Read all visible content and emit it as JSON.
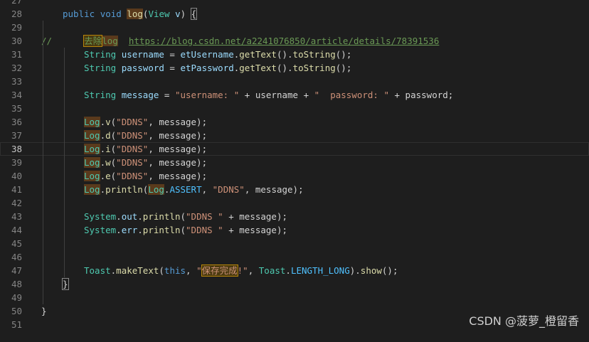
{
  "editor": {
    "lines": [
      {
        "num": "27",
        "indent": 0,
        "tokens": []
      },
      {
        "num": "28",
        "indent": 30,
        "tokens": [
          {
            "t": "public",
            "c": "kw"
          },
          {
            "t": " ",
            "c": "plain"
          },
          {
            "t": "void",
            "c": "kw"
          },
          {
            "t": " ",
            "c": "plain"
          },
          {
            "t": "log",
            "c": "fn",
            "h": "word"
          },
          {
            "t": "(",
            "c": "plain"
          },
          {
            "t": "View",
            "c": "type"
          },
          {
            "t": " ",
            "c": "plain"
          },
          {
            "t": "v",
            "c": "var"
          },
          {
            "t": ") ",
            "c": "plain"
          },
          {
            "t": "{",
            "c": "plain",
            "h": "brace"
          }
        ]
      },
      {
        "num": "29",
        "indent": 0,
        "tokens": []
      },
      {
        "num": "30",
        "indent": 0,
        "tokens": [
          {
            "t": "//      ",
            "c": "comment"
          },
          {
            "t": "去除",
            "c": "comment",
            "h": "box"
          },
          {
            "t": "log",
            "c": "comment",
            "h": "word"
          },
          {
            "t": "  ",
            "c": "comment"
          },
          {
            "t": "https://blog.csdn.net/a2241076850/article/details/78391536",
            "c": "link"
          }
        ]
      },
      {
        "num": "31",
        "indent": 60,
        "tokens": [
          {
            "t": "String",
            "c": "type"
          },
          {
            "t": " ",
            "c": "plain"
          },
          {
            "t": "username",
            "c": "var"
          },
          {
            "t": " = ",
            "c": "plain"
          },
          {
            "t": "etUsername",
            "c": "var"
          },
          {
            "t": ".",
            "c": "plain"
          },
          {
            "t": "getText",
            "c": "fn"
          },
          {
            "t": "().",
            "c": "plain"
          },
          {
            "t": "toString",
            "c": "fn"
          },
          {
            "t": "();",
            "c": "plain"
          }
        ]
      },
      {
        "num": "32",
        "indent": 60,
        "tokens": [
          {
            "t": "String",
            "c": "type"
          },
          {
            "t": " ",
            "c": "plain"
          },
          {
            "t": "password",
            "c": "var"
          },
          {
            "t": " = ",
            "c": "plain"
          },
          {
            "t": "etPassword",
            "c": "var"
          },
          {
            "t": ".",
            "c": "plain"
          },
          {
            "t": "getText",
            "c": "fn"
          },
          {
            "t": "().",
            "c": "plain"
          },
          {
            "t": "toString",
            "c": "fn"
          },
          {
            "t": "();",
            "c": "plain"
          }
        ]
      },
      {
        "num": "33",
        "indent": 0,
        "tokens": []
      },
      {
        "num": "34",
        "indent": 60,
        "tokens": [
          {
            "t": "String",
            "c": "type"
          },
          {
            "t": " ",
            "c": "plain"
          },
          {
            "t": "message",
            "c": "var"
          },
          {
            "t": " = ",
            "c": "plain"
          },
          {
            "t": "\"username: \"",
            "c": "str"
          },
          {
            "t": " + username + ",
            "c": "plain"
          },
          {
            "t": "\"  password: \"",
            "c": "str"
          },
          {
            "t": " + password;",
            "c": "plain"
          }
        ]
      },
      {
        "num": "35",
        "indent": 0,
        "tokens": []
      },
      {
        "num": "36",
        "indent": 60,
        "tokens": [
          {
            "t": "Log",
            "c": "type",
            "h": "word"
          },
          {
            "t": ".",
            "c": "plain"
          },
          {
            "t": "v",
            "c": "fn"
          },
          {
            "t": "(",
            "c": "plain"
          },
          {
            "t": "\"DDNS\"",
            "c": "str"
          },
          {
            "t": ", message);",
            "c": "plain"
          }
        ]
      },
      {
        "num": "37",
        "indent": 60,
        "tokens": [
          {
            "t": "Log",
            "c": "type",
            "h": "word"
          },
          {
            "t": ".",
            "c": "plain"
          },
          {
            "t": "d",
            "c": "fn"
          },
          {
            "t": "(",
            "c": "plain"
          },
          {
            "t": "\"DDNS\"",
            "c": "str"
          },
          {
            "t": ", message);",
            "c": "plain"
          }
        ]
      },
      {
        "num": "38",
        "indent": 60,
        "current": true,
        "tokens": [
          {
            "t": "Log",
            "c": "type",
            "h": "word"
          },
          {
            "t": ".",
            "c": "plain"
          },
          {
            "t": "i",
            "c": "fn"
          },
          {
            "t": "(",
            "c": "plain"
          },
          {
            "t": "\"DDNS\"",
            "c": "str"
          },
          {
            "t": ", message);",
            "c": "plain"
          }
        ]
      },
      {
        "num": "39",
        "indent": 60,
        "tokens": [
          {
            "t": "Log",
            "c": "type",
            "h": "word"
          },
          {
            "t": ".",
            "c": "plain"
          },
          {
            "t": "w",
            "c": "fn"
          },
          {
            "t": "(",
            "c": "plain"
          },
          {
            "t": "\"DDNS\"",
            "c": "str"
          },
          {
            "t": ", message);",
            "c": "plain"
          }
        ]
      },
      {
        "num": "40",
        "indent": 60,
        "tokens": [
          {
            "t": "Log",
            "c": "type",
            "h": "word"
          },
          {
            "t": ".",
            "c": "plain"
          },
          {
            "t": "e",
            "c": "fn"
          },
          {
            "t": "(",
            "c": "plain"
          },
          {
            "t": "\"DDNS\"",
            "c": "str"
          },
          {
            "t": ", message);",
            "c": "plain"
          }
        ]
      },
      {
        "num": "41",
        "indent": 60,
        "tokens": [
          {
            "t": "Log",
            "c": "type",
            "h": "word"
          },
          {
            "t": ".",
            "c": "plain"
          },
          {
            "t": "println",
            "c": "fn"
          },
          {
            "t": "(",
            "c": "plain"
          },
          {
            "t": "Log",
            "c": "type",
            "h": "word"
          },
          {
            "t": ".",
            "c": "plain"
          },
          {
            "t": "ASSERT",
            "c": "const"
          },
          {
            "t": ", ",
            "c": "plain"
          },
          {
            "t": "\"DDNS\"",
            "c": "str"
          },
          {
            "t": ", message);",
            "c": "plain"
          }
        ]
      },
      {
        "num": "42",
        "indent": 0,
        "tokens": []
      },
      {
        "num": "43",
        "indent": 60,
        "tokens": [
          {
            "t": "System",
            "c": "type"
          },
          {
            "t": ".",
            "c": "plain"
          },
          {
            "t": "out",
            "c": "var"
          },
          {
            "t": ".",
            "c": "plain"
          },
          {
            "t": "println",
            "c": "fn"
          },
          {
            "t": "(",
            "c": "plain"
          },
          {
            "t": "\"DDNS \"",
            "c": "str"
          },
          {
            "t": " + message);",
            "c": "plain"
          }
        ]
      },
      {
        "num": "44",
        "indent": 60,
        "tokens": [
          {
            "t": "System",
            "c": "type"
          },
          {
            "t": ".",
            "c": "plain"
          },
          {
            "t": "err",
            "c": "var"
          },
          {
            "t": ".",
            "c": "plain"
          },
          {
            "t": "println",
            "c": "fn"
          },
          {
            "t": "(",
            "c": "plain"
          },
          {
            "t": "\"DDNS \"",
            "c": "str"
          },
          {
            "t": " + message);",
            "c": "plain"
          }
        ]
      },
      {
        "num": "45",
        "indent": 0,
        "tokens": []
      },
      {
        "num": "46",
        "indent": 0,
        "tokens": []
      },
      {
        "num": "47",
        "indent": 60,
        "tokens": [
          {
            "t": "Toast",
            "c": "type"
          },
          {
            "t": ".",
            "c": "plain"
          },
          {
            "t": "makeText",
            "c": "fn"
          },
          {
            "t": "(",
            "c": "plain"
          },
          {
            "t": "this",
            "c": "kw"
          },
          {
            "t": ", ",
            "c": "plain"
          },
          {
            "t": "\"",
            "c": "str"
          },
          {
            "t": "保存完成",
            "c": "str",
            "h": "box"
          },
          {
            "t": "!\"",
            "c": "str"
          },
          {
            "t": ", ",
            "c": "plain"
          },
          {
            "t": "Toast",
            "c": "type"
          },
          {
            "t": ".",
            "c": "plain"
          },
          {
            "t": "LENGTH_LONG",
            "c": "const"
          },
          {
            "t": ").",
            "c": "plain"
          },
          {
            "t": "show",
            "c": "fn"
          },
          {
            "t": "();",
            "c": "plain"
          }
        ]
      },
      {
        "num": "48",
        "indent": 30,
        "tokens": [
          {
            "t": "}",
            "c": "plain",
            "h": "brace"
          }
        ]
      },
      {
        "num": "49",
        "indent": 0,
        "tokens": []
      },
      {
        "num": "50",
        "indent": 0,
        "tokens": [
          {
            "t": "}",
            "c": "plain"
          }
        ]
      },
      {
        "num": "51",
        "indent": 0,
        "tokens": []
      }
    ]
  },
  "watermark": "CSDN @菠萝_橙留香"
}
